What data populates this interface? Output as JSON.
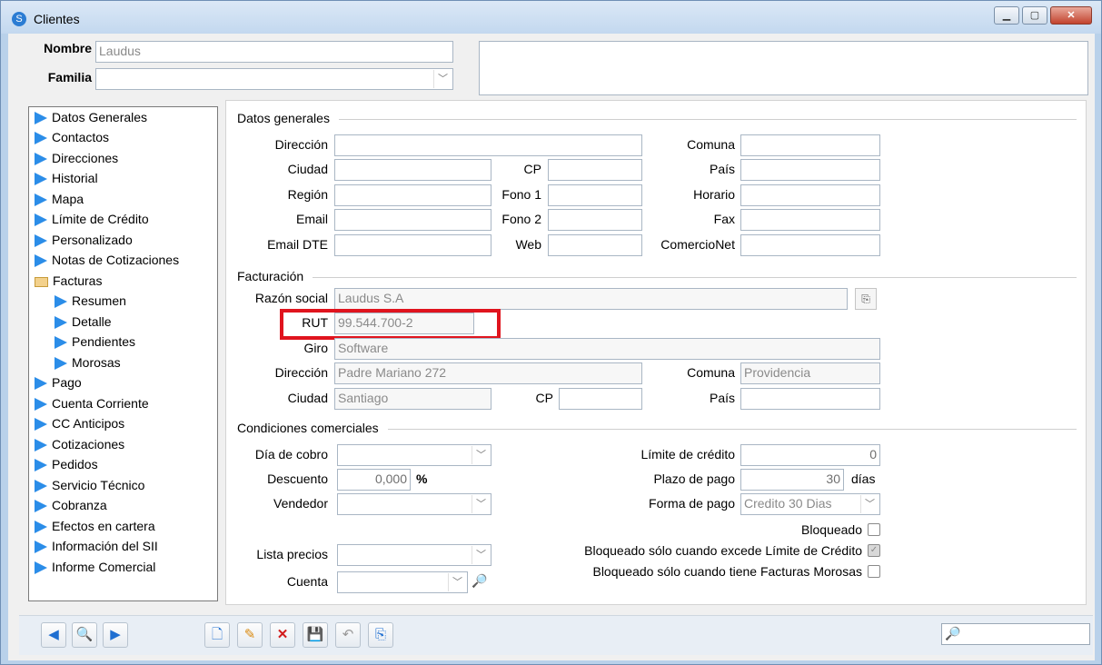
{
  "window": {
    "title": "Clientes",
    "minimize": "▁",
    "maximize": "▢",
    "close": "✕"
  },
  "header": {
    "nombre_label": "Nombre",
    "nombre_value": "Laudus",
    "familia_label": "Familia",
    "familia_value": ""
  },
  "sidebar": {
    "items": [
      {
        "label": "Datos Generales"
      },
      {
        "label": "Contactos"
      },
      {
        "label": "Direcciones"
      },
      {
        "label": "Historial"
      },
      {
        "label": "Mapa"
      },
      {
        "label": "Límite de Crédito"
      },
      {
        "label": "Personalizado"
      },
      {
        "label": "Notas de Cotizaciones"
      },
      {
        "label": "Facturas"
      },
      {
        "label": "Resumen"
      },
      {
        "label": "Detalle"
      },
      {
        "label": "Pendientes"
      },
      {
        "label": "Morosas"
      },
      {
        "label": "Pago"
      },
      {
        "label": "Cuenta Corriente"
      },
      {
        "label": "CC Anticipos"
      },
      {
        "label": "Cotizaciones"
      },
      {
        "label": "Pedidos"
      },
      {
        "label": "Servicio Técnico"
      },
      {
        "label": "Cobranza"
      },
      {
        "label": "Efectos en cartera"
      },
      {
        "label": "Información del SII"
      },
      {
        "label": "Informe Comercial"
      }
    ]
  },
  "datos_generales": {
    "section_title": "Datos generales",
    "direccion_label": "Dirección",
    "ciudad_label": "Ciudad",
    "region_label": "Región",
    "email_label": "Email",
    "email_dte_label": "Email DTE",
    "cp_label": "CP",
    "fono1_label": "Fono 1",
    "fono2_label": "Fono 2",
    "web_label": "Web",
    "comuna_label": "Comuna",
    "pais_label": "País",
    "horario_label": "Horario",
    "fax_label": "Fax",
    "comercionet_label": "ComercioNet"
  },
  "facturacion": {
    "section_title": "Facturación",
    "razon_social_label": "Razón social",
    "razon_social_value": "Laudus S.A",
    "rut_label": "RUT",
    "rut_value": "99.544.700-2",
    "giro_label": "Giro",
    "giro_value": "Software",
    "direccion_label": "Dirección",
    "direccion_value": "Padre Mariano 272",
    "comuna_label": "Comuna",
    "comuna_value": "Providencia",
    "ciudad_label": "Ciudad",
    "ciudad_value": "Santiago",
    "cp_label": "CP",
    "pais_label": "País"
  },
  "condiciones": {
    "section_title": "Condiciones comerciales",
    "dia_cobro_label": "Día de cobro",
    "descuento_label": "Descuento",
    "descuento_value": "0,000",
    "percent": "%",
    "vendedor_label": "Vendedor",
    "lista_precios_label": "Lista precios",
    "cuenta_label": "Cuenta",
    "limite_credito_label": "Límite de crédito",
    "limite_credito_value": "0",
    "plazo_pago_label": "Plazo de pago",
    "plazo_pago_value": "30",
    "dias": "días",
    "forma_pago_label": "Forma de pago",
    "forma_pago_value": "Credito 30 Dias",
    "bloqueado_label": "Bloqueado",
    "bloqueado_limite_label": "Bloqueado sólo cuando excede Límite de Crédito",
    "bloqueado_morosas_label": "Bloqueado sólo cuando tiene Facturas Morosas"
  },
  "toolbar": {
    "prev": "◀",
    "find": "🔍",
    "next": "▶",
    "new": "🗋",
    "edit": "✎",
    "delete": "✕",
    "save": "💾",
    "undo": "↶",
    "copy": "⎘",
    "search_icon": "🔎"
  }
}
